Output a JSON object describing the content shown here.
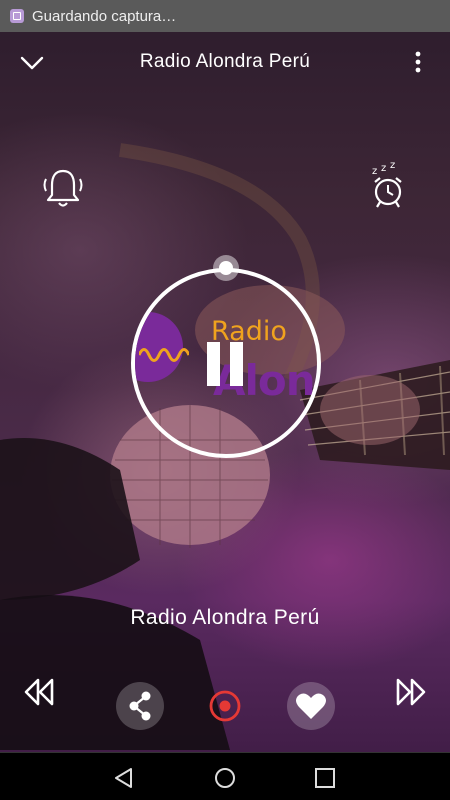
{
  "status_bar": {
    "text": "Guardando captura…",
    "icon": "screenshot-icon"
  },
  "header": {
    "title": "Radio Alondra Perú",
    "back_icon": "chevron-down-icon",
    "menu_icon": "more-vert-icon"
  },
  "top_icons": {
    "left": "alarm-bell-icon",
    "right": "sleep-timer-icon"
  },
  "player": {
    "logo_text_top": "Radio",
    "logo_text_bottom": "Alondra",
    "state_icon": "pause-icon"
  },
  "station_name": "Radio Alondra Perú",
  "controls": {
    "previous": "rewind-icon",
    "share": "share-icon",
    "record": "record-icon",
    "favorite": "heart-icon",
    "next": "fast-forward-icon"
  },
  "colors": {
    "logo_orange": "#f0a31e",
    "logo_purple": "#7a2a9a",
    "record_red": "#e53935"
  },
  "nav_bar": {
    "back": "nav-back-icon",
    "home": "nav-home-icon",
    "recents": "nav-recents-icon"
  }
}
